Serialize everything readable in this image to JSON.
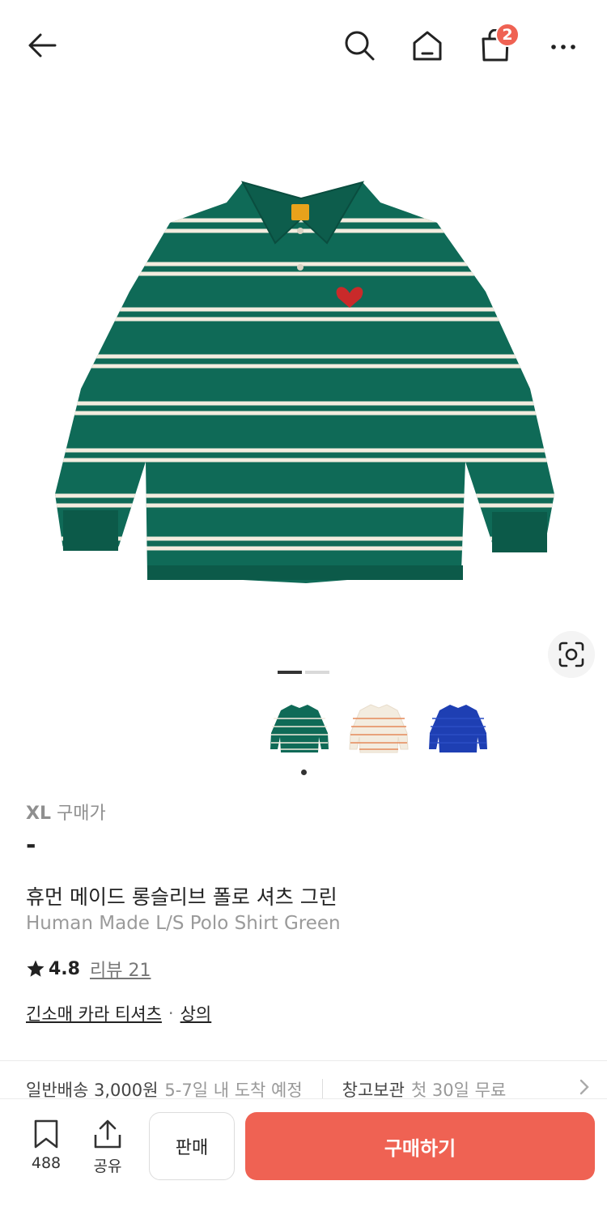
{
  "header": {
    "cart_count": "2"
  },
  "product": {
    "size_label": "XL",
    "price_label": "구매가",
    "price": "-",
    "name_ko": "휴먼 메이드 롱슬리브 폴로 셔츠 그린",
    "name_en": "Human Made L/S Polo Shirt Green",
    "rating": "4.8",
    "review_label": "리뷰 21",
    "category_1": "긴소매 카라 티셔츠",
    "category_sep": "·",
    "category_2": "상의"
  },
  "colors": {
    "accent": "#ef6253",
    "shirt_green": "#0f6a57",
    "shirt_cream": "#f3ecdf",
    "shirt_blue": "#1e3fb3"
  },
  "gallery": {
    "page_index": 1,
    "page_count": 2,
    "thumbnails": [
      "green-polo",
      "cream-orange-polo",
      "blue-polo"
    ]
  },
  "shipping": {
    "main": "일반배송 3,000원",
    "eta": "5-7일 내 도착 예정",
    "storage": "창고보관",
    "storage_note": "첫 30일 무료"
  },
  "bottom": {
    "save_count": "488",
    "share_label": "공유",
    "sell_label": "판매",
    "buy_label": "구매하기"
  }
}
